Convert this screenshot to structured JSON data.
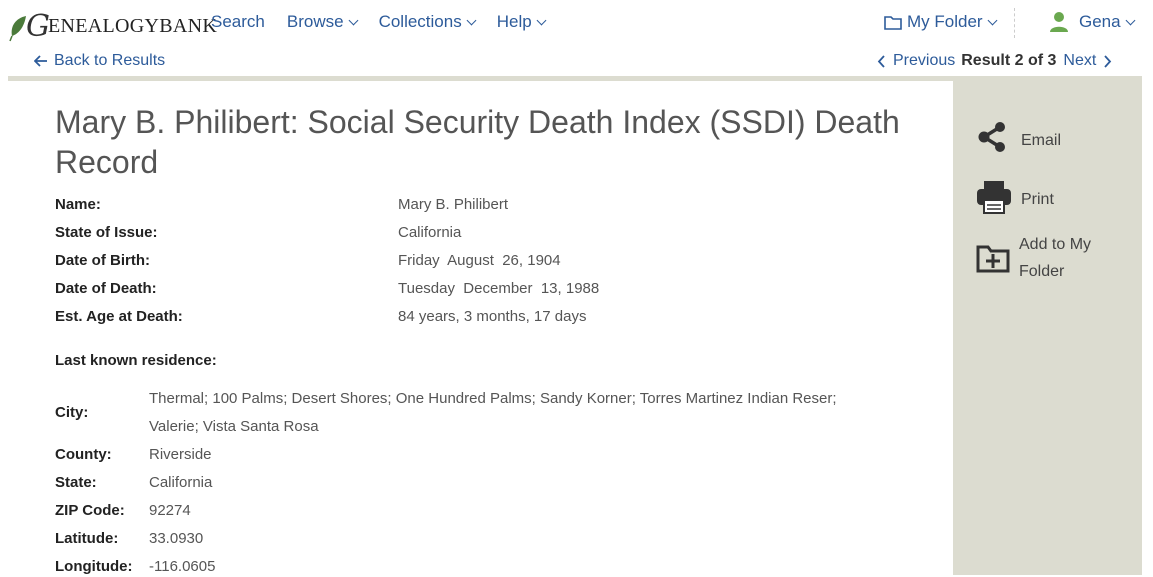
{
  "brand": {
    "script_letter": "G",
    "wordmark": "ENEALOGYBANK"
  },
  "nav": {
    "search": "Search",
    "browse": "Browse",
    "collections": "Collections",
    "help": "Help",
    "my_folder": "My Folder",
    "user": "Gena"
  },
  "subnav": {
    "back": "Back to Results",
    "previous": "Previous",
    "result_status": "Result 2 of 3",
    "next": "Next"
  },
  "record": {
    "title": "Mary B. Philibert: Social Security Death Index (SSDI) Death Record",
    "fields": [
      {
        "label": "Name:",
        "value": "Mary B. Philibert"
      },
      {
        "label": "State of Issue:",
        "value": "California"
      },
      {
        "label": "Date of Birth:",
        "value": "Friday  August  26, 1904"
      },
      {
        "label": "Date of Death:",
        "value": "Tuesday  December  13, 1988"
      },
      {
        "label": "Est. Age at Death:",
        "value": "84 years, 3 months, 17 days"
      }
    ],
    "residence_heading": "Last known residence:",
    "residence": {
      "city_label": "City:",
      "city_line1": "Thermal; 100 Palms; Desert Shores; One Hundred Palms; Sandy Korner; Torres Martinez Indian Reser;",
      "city_line2": "Valerie; Vista Santa Rosa",
      "county_label": "County:",
      "county": "Riverside",
      "state_label": "State:",
      "state": "California",
      "zip_label": "ZIP Code:",
      "zip": "92274",
      "lat_label": "Latitude:",
      "lat": "33.0930",
      "lon_label": "Longitude:",
      "lon": "-116.0605"
    }
  },
  "actions": {
    "email": "Email",
    "print": "Print",
    "add_line1": "Add to My",
    "add_line2": "Folder"
  },
  "icons": {
    "leaf": "leaf-logo-icon",
    "folder": "folder-icon",
    "user": "user-icon",
    "arrow_left": "arrow-left-icon",
    "chevron_left": "chevron-left-icon",
    "chevron_right": "chevron-right-icon",
    "share": "share-icon",
    "printer": "printer-icon",
    "folder_add": "folder-add-icon"
  },
  "colors": {
    "link": "#2d5b9a",
    "user_green": "#6aa84f",
    "sidebar_bg": "#dcdcd0"
  }
}
